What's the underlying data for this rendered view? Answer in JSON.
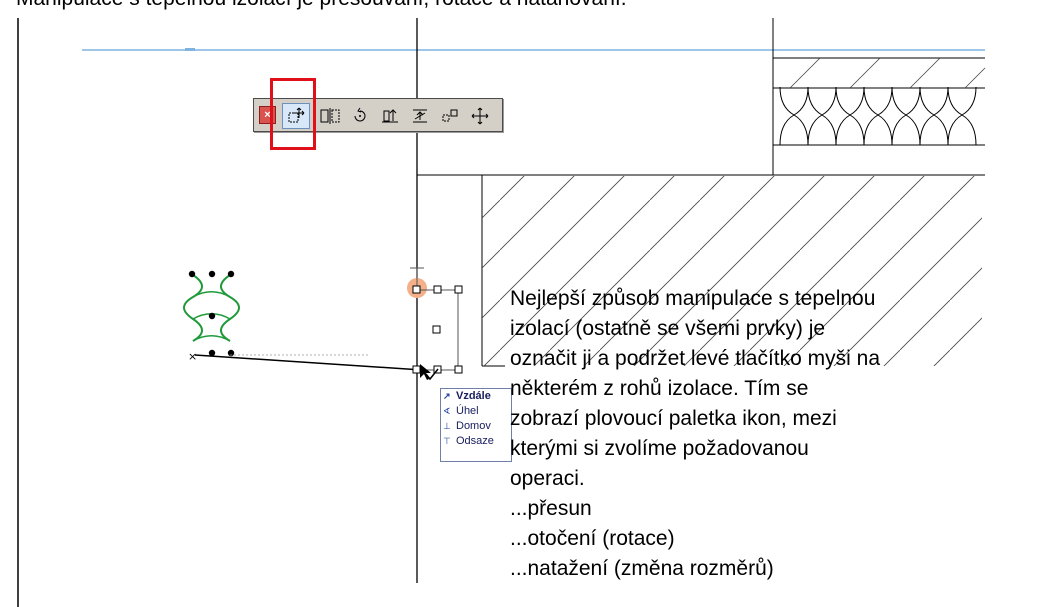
{
  "heading": "Manipulace s tepelnou izolací je přesouvání, rotace a natahování.",
  "palette": {
    "close_label": "×",
    "buttons": [
      {
        "icon": "move-drag-icon",
        "active": true
      },
      {
        "icon": "mirror-icon",
        "active": false
      },
      {
        "icon": "rotate-icon",
        "active": false
      },
      {
        "icon": "elevate-icon",
        "active": false
      },
      {
        "icon": "stretch-icon",
        "active": false
      },
      {
        "icon": "multiply-icon",
        "active": false
      },
      {
        "icon": "offset-icon",
        "active": false
      }
    ]
  },
  "tracker_popup": {
    "items": [
      {
        "icon": "distance-icon",
        "label": "Vzdále",
        "bold": true
      },
      {
        "icon": "angle-icon",
        "label": "Úhel",
        "bold": false
      },
      {
        "icon": "home-story-icon",
        "label": "Domov",
        "bold": false
      },
      {
        "icon": "offset-icon",
        "label": "Odsaze",
        "bold": false
      }
    ]
  },
  "description": {
    "lines": [
      "Nejlepší způsob manipulace s tepelnou",
      "izolací (ostatně se všemi prvky) je",
      "označit ji a podržet levé tlačítko myši na",
      "některém z rohů izolace. Tím se",
      "zobrazí plovoucí paletka ikon, mezi",
      "kterými si zvolíme požadovanou",
      "operaci.",
      "...přesun",
      "...otočení (rotace)",
      "...natažení (změna rozměrů)"
    ]
  },
  "colors": {
    "highlight": "#e0101b",
    "insulation_green": "#1f9a3a",
    "palette_bg": "#d4d0c8",
    "ruler_blue": "#7fb3e0"
  }
}
